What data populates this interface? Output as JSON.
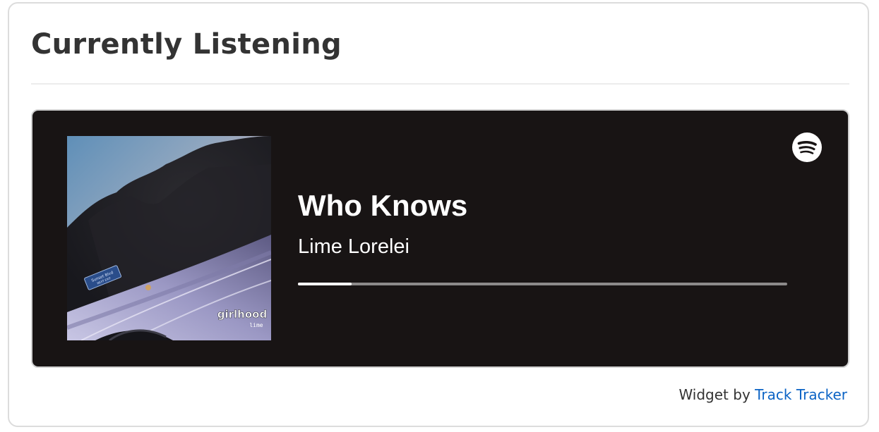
{
  "widget": {
    "title": "Currently Listening"
  },
  "player": {
    "track_title": "Who Knows",
    "artist": "Lime Lorelei",
    "progress_fraction": 0.11,
    "service_icon": "spotify-icon",
    "album_art": {
      "depicts": "album-cover-icon",
      "logo_text": "girlhood",
      "logo_subtext": "lime",
      "sign_text": "Sunset Blvd"
    },
    "colors": {
      "background": "#181414",
      "progress_fill": "#ffffff",
      "progress_track": "#8c8a8a"
    }
  },
  "footer": {
    "prefix": "Widget by",
    "link_text": "Track Tracker",
    "link_color": "#0b63c5"
  }
}
